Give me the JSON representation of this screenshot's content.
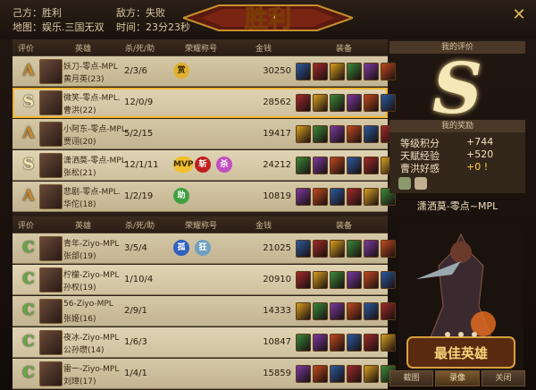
{
  "header": {
    "self_side": "己方：胜利",
    "enemy_side": "敌方：失败",
    "map": "地图：娱乐.三国无双",
    "time": "时间：23分23秒",
    "banner_text": "胜利"
  },
  "columns": {
    "rank": "评价",
    "hero": "英雄",
    "kda": "杀/死/助",
    "honor": "荣耀称号",
    "gold": "金钱",
    "equip": "装备"
  },
  "team1": [
    {
      "rank": "A",
      "name": "妖刀-零点-MPL",
      "hero": "黄月英(23)",
      "kda": "2/3/6",
      "honors": [
        "赏"
      ],
      "gold": "30250",
      "sel": false
    },
    {
      "rank": "S",
      "name": "微笑-零点-MPL.",
      "hero": "曹洪(22)",
      "kda": "12/0/9",
      "honors": [],
      "gold": "28562",
      "sel": true
    },
    {
      "rank": "A",
      "name": "小阿东-零点-MPL.",
      "hero": "贾诩(20)",
      "kda": "5/2/15",
      "honors": [],
      "gold": "19417",
      "sel": false
    },
    {
      "rank": "S",
      "name": "潇洒莫-零点-MPL.",
      "hero": "张松(21)",
      "kda": "12/1/11",
      "honors": [
        "MVP",
        "斩",
        "杀"
      ],
      "gold": "24212",
      "sel": false
    },
    {
      "rank": "A",
      "name": "悲剧-零点-MPL.",
      "hero": "华佗(18)",
      "kda": "1/2/19",
      "honors": [
        "助"
      ],
      "gold": "10819",
      "sel": false
    }
  ],
  "team2": [
    {
      "rank": "C",
      "name": "青年-Ziyo-MPL",
      "hero": "张郃(19)",
      "kda": "3/5/4",
      "honors": [
        "孤",
        "狂"
      ],
      "gold": "21025"
    },
    {
      "rank": "C",
      "name": "柠檬-Ziyo-MPL",
      "hero": "孙权(19)",
      "kda": "1/10/4",
      "honors": [],
      "gold": "20910"
    },
    {
      "rank": "C",
      "name": "56-Ziyo-MPL",
      "hero": "张姬(16)",
      "kda": "2/9/1",
      "honors": [],
      "gold": "14333"
    },
    {
      "rank": "C",
      "name": "夜冰-Ziyo-MPL",
      "hero": "公孙瓒(14)",
      "kda": "1/6/3",
      "honors": [],
      "gold": "10847"
    },
    {
      "rank": "C",
      "name": "雷一-Ziyo-MPL",
      "hero": "刘璋(17)",
      "kda": "1/4/1",
      "honors": [],
      "gold": "15859"
    }
  ],
  "right_panel": {
    "my_eval_title": "我的评价",
    "my_grade": "S",
    "rewards_title": "我的奖励",
    "rewards": [
      {
        "label": "等级积分",
        "value": "+744"
      },
      {
        "label": "天赋经验",
        "value": "+520"
      },
      {
        "label": "曹洪好感",
        "value": "+0 !"
      }
    ],
    "mvp_player": "潇洒莫-零点~MPL",
    "mvp_badge": "最佳英雄"
  },
  "buttons": {
    "screenshot": "截图",
    "replay": "录像",
    "close": "关闭"
  },
  "colors": {
    "rank_S": "#f5e9b0",
    "rank_A": "#c98a2a",
    "rank_C": "#5fae3a",
    "selection_border": "#f2b32b"
  }
}
